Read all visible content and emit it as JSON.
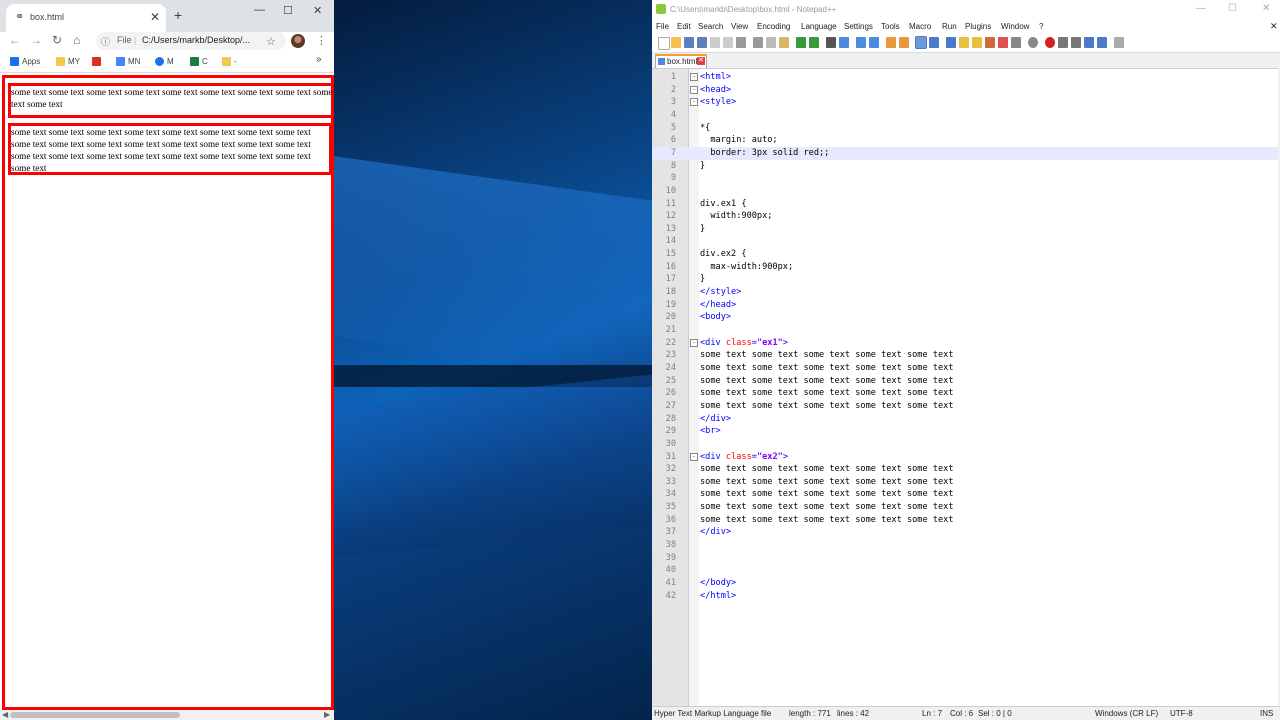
{
  "chrome": {
    "tab_title": "box.html",
    "url_scheme": "File",
    "url": "C:/Users/markb/Desktop/...",
    "bookmarks": [
      {
        "label": "Apps",
        "color": "#1a73e8"
      },
      {
        "label": "MY",
        "color": "#f2c94c"
      },
      {
        "label": "",
        "color": "#d93025"
      },
      {
        "label": "MN",
        "color": "#4285f4"
      },
      {
        "label": "M",
        "color": "#1a73e8"
      },
      {
        "label": "C",
        "color": "#188038"
      },
      {
        "label": "-",
        "color": "#f2c94c"
      }
    ],
    "bookmarks_overflow": "»"
  },
  "page": {
    "ex1_text": "some text some text some text some text some text some text some text some text some text some text some text some text some text some text some text some text some text some text some text some text some text some text some text some text some text",
    "ex2_text": "some text some text some text some text some text some text some text some text some text some text some text some text some text some text some text some text some text some text some text some text some text some text some text some text some text"
  },
  "notepad": {
    "title": "C:\\Users\\markb\\Desktop\\box.html - Notepad++",
    "menu": [
      "File",
      "Edit",
      "Search",
      "View",
      "Encoding",
      "Language",
      "Settings",
      "Tools",
      "Macro",
      "Run",
      "Plugins",
      "Window",
      "?"
    ],
    "file_tab": "box.html",
    "lines": [
      "<html>",
      "<head>",
      "<style>",
      "",
      "*{",
      "  margin: auto;",
      "  border: 3px solid red;;",
      "}",
      "",
      "",
      "div.ex1 {",
      "  width:900px;",
      "}",
      "",
      "div.ex2 {",
      "  max-width:900px;",
      "}",
      "</style>",
      "</head>",
      "<body>",
      "",
      "<div class=\"ex1\">",
      "some text some text some text some text some text",
      "some text some text some text some text some text",
      "some text some text some text some text some text",
      "some text some text some text some text some text",
      "some text some text some text some text some text",
      "</div>",
      "<br>",
      "",
      "<div class=\"ex2\">",
      "some text some text some text some text some text",
      "some text some text some text some text some text",
      "some text some text some text some text some text",
      "some text some text some text some text some text",
      "some text some text some text some text some text",
      "</div>",
      "",
      "",
      "",
      "</body>",
      "</html>"
    ],
    "active_line": 7,
    "status": {
      "file_type": "Hyper Text Markup Language file",
      "length": "length : 771",
      "lines": "lines : 42",
      "ln": "Ln : 7",
      "col": "Col : 6",
      "sel": "Sel : 0 | 0",
      "eol": "Windows (CR LF)",
      "encoding": "UTF-8",
      "mode": "INS"
    }
  }
}
